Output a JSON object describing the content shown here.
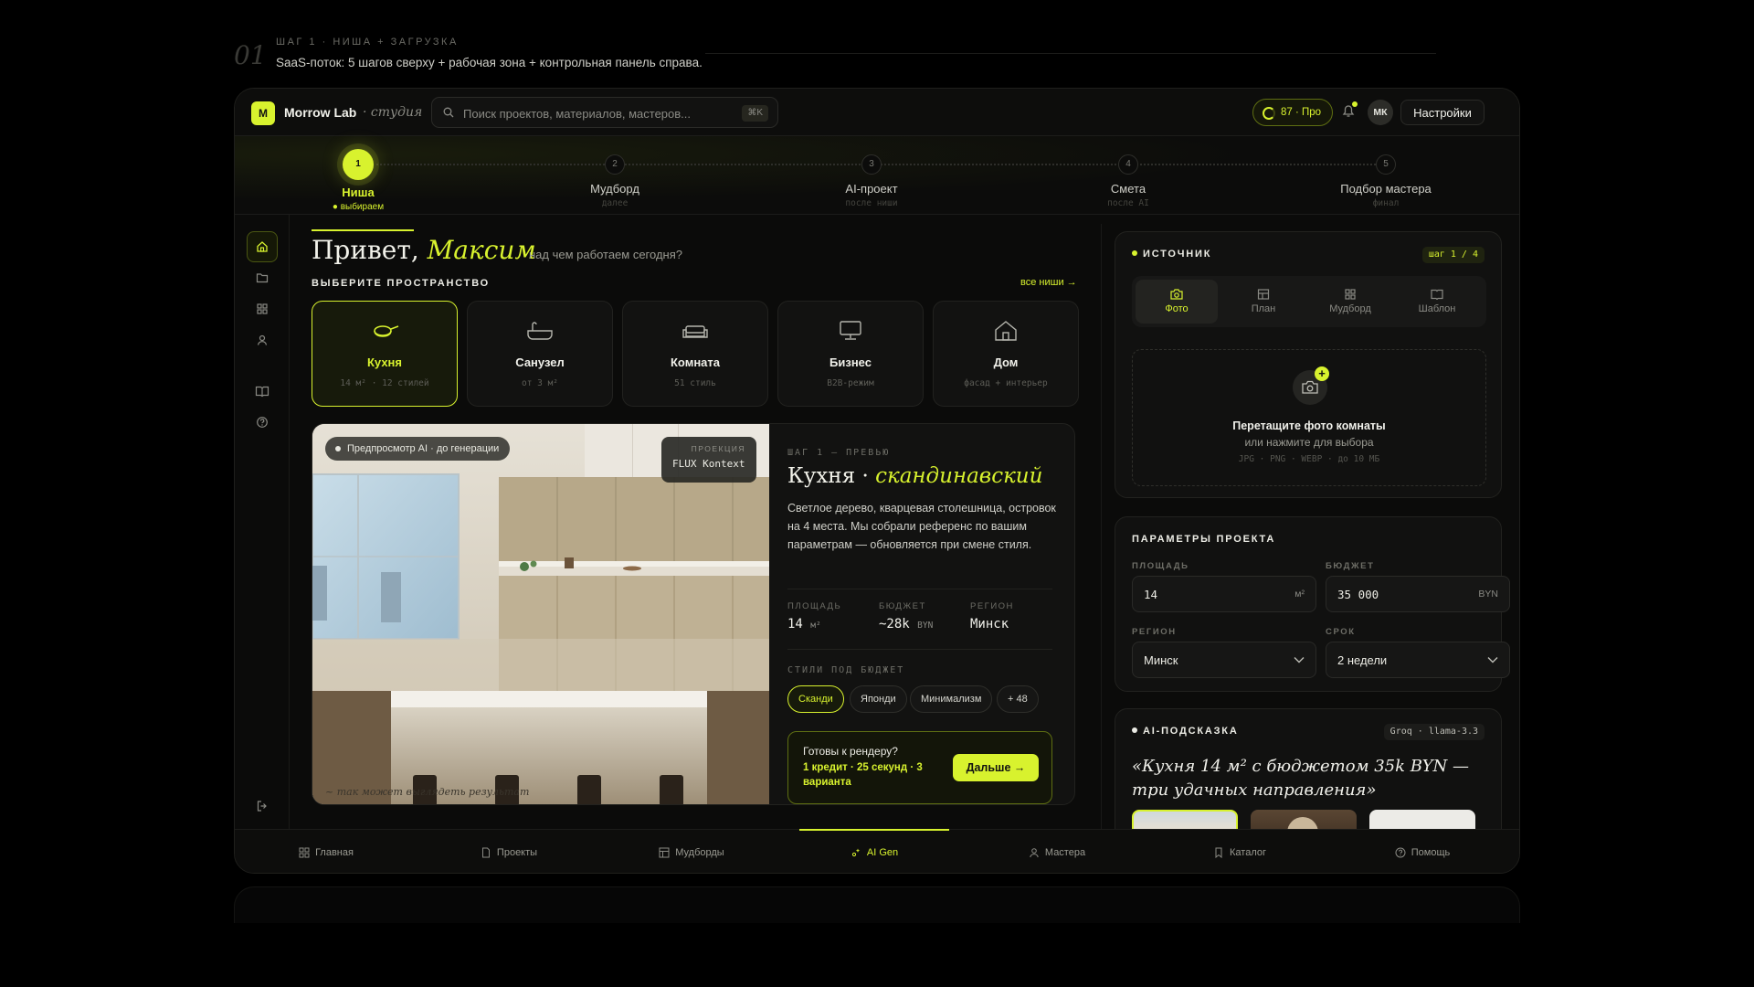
{
  "annotation": {
    "number": "01",
    "kicker": "ШАГ 1 · НИША + ЗАГРУЗКА",
    "description": "SaaS-поток: 5 шагов сверху + рабочая зона + контрольная панель справа."
  },
  "colors": {
    "accent": "#d8f22e",
    "background": "#0b0b0a",
    "card": "#121211"
  },
  "topbar": {
    "logo_letter": "M",
    "brand": "Morrow Lab",
    "brand_sub": "· студия",
    "search_placeholder": "Поиск проектов, материалов, мастеров...",
    "search_shortcut": "⌘K",
    "credits": "87 · Про",
    "avatar": "МК",
    "settings_label": "Настройки",
    "icons": [
      "search-icon",
      "bell-icon"
    ]
  },
  "steps": [
    {
      "num": "1",
      "label": "Ниша",
      "sub": "● выбираем"
    },
    {
      "num": "2",
      "label": "Мудборд",
      "sub": "далее"
    },
    {
      "num": "3",
      "label": "AI-проект",
      "sub": "после ниши"
    },
    {
      "num": "4",
      "label": "Смета",
      "sub": "после AI"
    },
    {
      "num": "5",
      "label": "Подбор мастера",
      "sub": "финал"
    }
  ],
  "rail": {
    "icons": [
      "home-icon",
      "folder-icon",
      "grid-icon",
      "user-icon",
      "book-icon",
      "help-icon",
      "logout-icon"
    ]
  },
  "main": {
    "greeting": "Привет,",
    "greeting_name": "Максим",
    "greeting_sub": "над чем работаем сегодня?",
    "section_title": "ВЫБЕРИТЕ ПРОСТРАНСТВО",
    "all_link": "все ниши →",
    "niches": [
      {
        "name": "Кухня",
        "meta": "14 м² · 12 стилей",
        "icon": "pan-icon"
      },
      {
        "name": "Санузел",
        "meta": "от 3 м²",
        "icon": "bathtub-icon"
      },
      {
        "name": "Комната",
        "meta": "51 стиль",
        "icon": "sofa-icon"
      },
      {
        "name": "Бизнес",
        "meta": "B2B-режим",
        "icon": "monitor-icon"
      },
      {
        "name": "Дом",
        "meta": "фасад + интерьер",
        "icon": "house-icon"
      }
    ],
    "preview": {
      "pill": "Предпросмотр AI · до генерации",
      "projection_label": "ПРОЕКЦИЯ",
      "projection_value": "FLUX Kontext",
      "caption": "~ так может выглядеть результат",
      "kicker": "ШАГ 1 — ПРЕВЬЮ",
      "title": "Кухня ·",
      "title_style": "скандинавский",
      "description": "Светлое дерево, кварцевая столешница, островок на 4 места. Мы собрали референс по вашим параметрам — обновляется при смене стиля.",
      "stats": [
        {
          "label": "ПЛОЩАДЬ",
          "value": "14",
          "unit": "м²"
        },
        {
          "label": "БЮДЖЕТ",
          "value": "~28k",
          "unit": "BYN"
        },
        {
          "label": "РЕГИОН",
          "value": "Минск",
          "unit": ""
        }
      ],
      "styles_title": "СТИЛИ ПОД БЮДЖЕТ",
      "styles": [
        "Сканди",
        "Японди",
        "Минимализм",
        "+ 48"
      ],
      "cta_question": "Готовы к рендеру?",
      "cta_detail": "1 кредит · 25 секунд · 3 варианта",
      "cta_button": "Дальше"
    }
  },
  "source": {
    "title": "ИСТОЧНИК",
    "badge": "шаг 1 / 4",
    "tabs": [
      {
        "label": "Фото",
        "icon": "camera-icon"
      },
      {
        "label": "План",
        "icon": "plan-icon"
      },
      {
        "label": "Мудборд",
        "icon": "grid-icon"
      },
      {
        "label": "Шаблон",
        "icon": "book-icon"
      }
    ],
    "drop_title": "Перетащите фото комнаты",
    "drop_sub": "или нажмите для выбора",
    "drop_formats": "JPG · PNG · WEBP · до 10 МБ"
  },
  "params": {
    "title": "ПАРАМЕТРЫ ПРОЕКТА",
    "area_label": "ПЛОЩАДЬ",
    "area_value": "14",
    "area_unit": "м²",
    "budget_label": "БЮДЖЕТ",
    "budget_value": "35 000",
    "budget_unit": "BYN",
    "region_label": "РЕГИОН",
    "region_value": "Минск",
    "term_label": "СРОК",
    "term_value": "2 недели"
  },
  "hint": {
    "title": "AI-ПОДСКАЗКА",
    "badge": "Groq · llama-3.3",
    "text": "«Кухня 14 м² с бюджетом 35k BYN — три удачных направления»"
  },
  "bottom_nav": [
    {
      "label": "Главная",
      "icon": "grid-icon"
    },
    {
      "label": "Проекты",
      "icon": "file-icon"
    },
    {
      "label": "Мудборды",
      "icon": "layout-icon"
    },
    {
      "label": "AI Gen",
      "icon": "sparkle-icon"
    },
    {
      "label": "Мастера",
      "icon": "user-icon"
    },
    {
      "label": "Каталог",
      "icon": "bookmark-icon"
    },
    {
      "label": "Помощь",
      "icon": "help-icon"
    }
  ]
}
